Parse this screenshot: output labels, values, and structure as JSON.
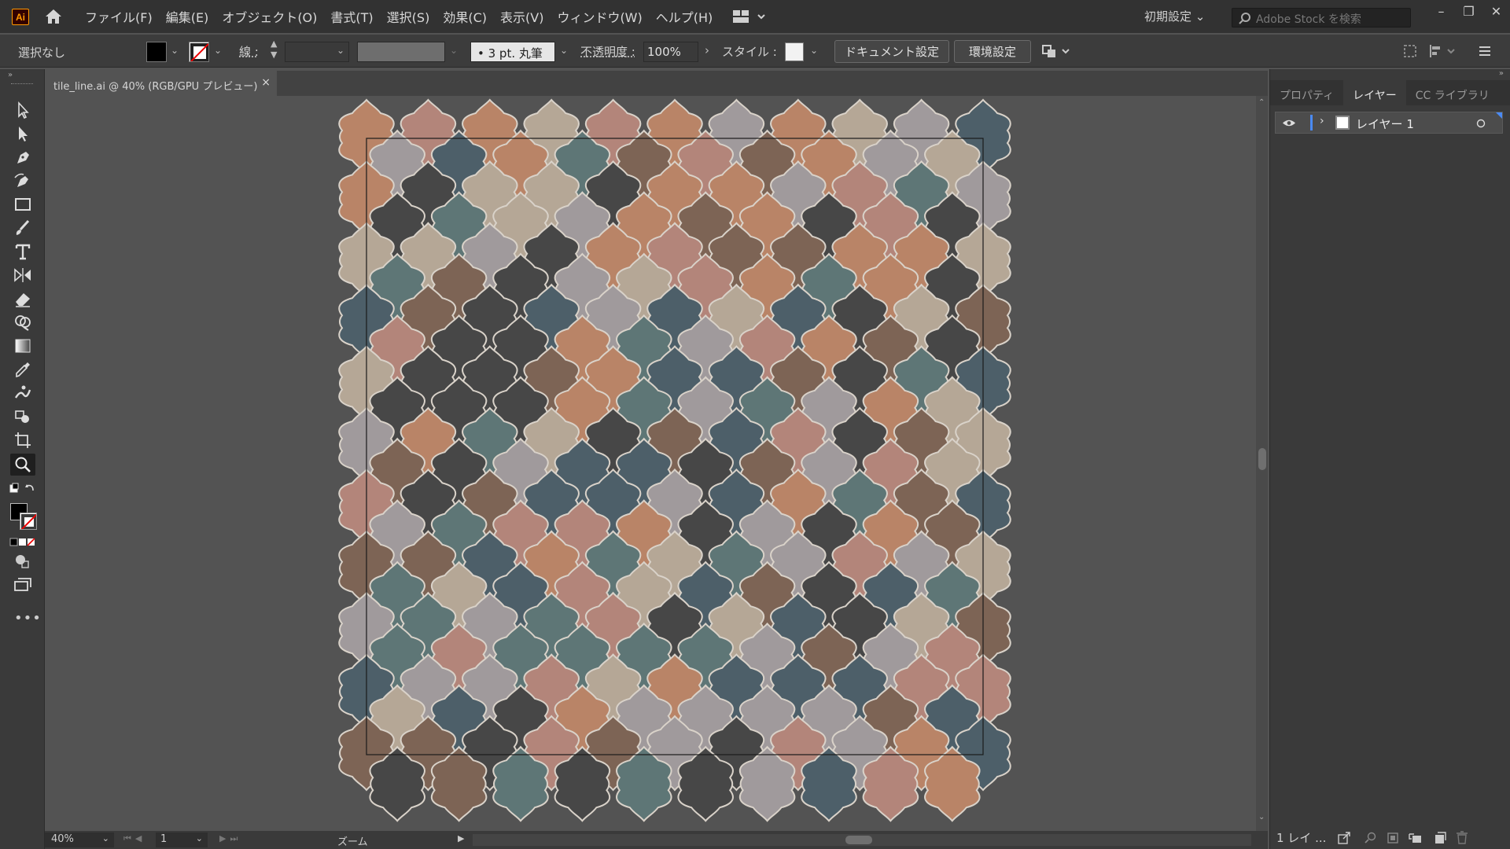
{
  "app": {
    "logo": "Ai",
    "home_icon": "home-icon"
  },
  "menu": [
    "ファイル(F)",
    "編集(E)",
    "オブジェクト(O)",
    "書式(T)",
    "選択(S)",
    "効果(C)",
    "表示(V)",
    "ウィンドウ(W)",
    "ヘルプ(H)"
  ],
  "topright": {
    "preset": "初期設定",
    "stock_placeholder": "Adobe Stock を検索"
  },
  "control": {
    "selection": "選択なし",
    "stroke_label": "線 :",
    "brush": "3 pt. 丸筆",
    "opacity_label": "不透明度 :",
    "opacity_value": "100%",
    "style_label": "スタイル :",
    "doc_setup": "ドキュメント設定",
    "prefs": "環境設定"
  },
  "document": {
    "tab_title": "tile_line.ai @ 40% (RGB/GPU プレビュー)",
    "close": "×"
  },
  "status": {
    "zoom": "40%",
    "page": "1",
    "tool": "ズーム"
  },
  "panel": {
    "tabs": [
      "プロパティ",
      "レイヤー",
      "CC ライブラリ"
    ],
    "active_tab": 1,
    "layer_name": "レイヤー 1",
    "footer_count": "1 レイ ..."
  },
  "colors": {
    "tile_palette": [
      "#b98467",
      "#b3857a",
      "#b5a796",
      "#5e7676",
      "#474747",
      "#4d5f69",
      "#7d6455",
      "#a09a9c"
    ],
    "tile_outline": "#d9d2c9",
    "artboard_border": "#1a1a1a",
    "accent": "#4a8af4"
  }
}
